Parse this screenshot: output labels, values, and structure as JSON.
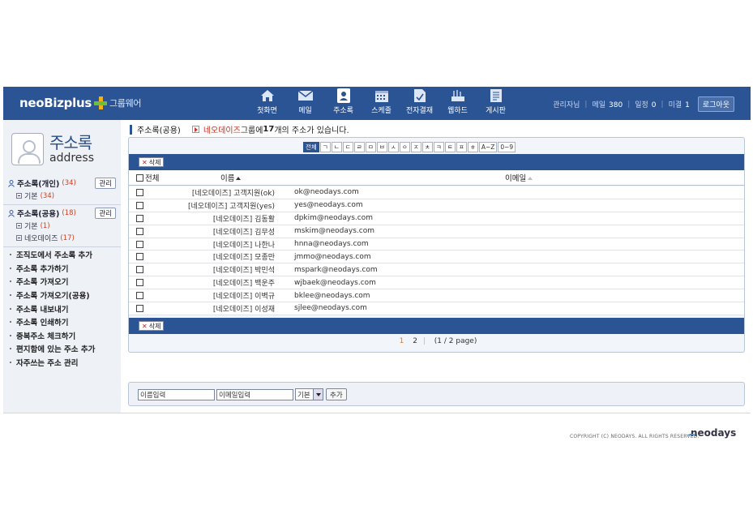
{
  "header": {
    "logo_main": "neoBizplus",
    "logo_sub": "그룹웨어",
    "nav": [
      {
        "label": "첫화면",
        "icon": "home-icon"
      },
      {
        "label": "메일",
        "icon": "mail-icon"
      },
      {
        "label": "주소록",
        "icon": "addressbook-icon",
        "active": true
      },
      {
        "label": "스케줄",
        "icon": "calendar-icon"
      },
      {
        "label": "전자결재",
        "icon": "approval-icon"
      },
      {
        "label": "웹하드",
        "icon": "webhard-icon"
      },
      {
        "label": "게시판",
        "icon": "board-icon"
      }
    ],
    "user_name": "관리자님",
    "mail_label": "메일",
    "mail_count": "380",
    "schedule_label": "일정",
    "schedule_count": "0",
    "pending_label": "미결",
    "pending_count": "1",
    "logout_label": "로그아웃"
  },
  "sidebar": {
    "title_ko": "주소록",
    "title_en": "address",
    "personal": {
      "label": "주소록(개인)",
      "count": "(34)",
      "manage": "관리",
      "subs": [
        {
          "label": "기본",
          "count": "(34)"
        }
      ]
    },
    "shared": {
      "label": "주소록(공용)",
      "count": "(18)",
      "manage": "관리",
      "subs": [
        {
          "label": "기본",
          "count": "(1)"
        },
        {
          "label": "네오데이즈",
          "count": "(17)"
        }
      ]
    },
    "menu": [
      "조직도에서 주소록 추가",
      "주소록 추가하기",
      "주소록 가져오기",
      "주소록 가져오기(공용)",
      "주소록 내보내기",
      "주소록 인쇄하기",
      "중복주소 체크하기",
      "편지함에 있는 주소 추가",
      "자주쓰는 주소 관리"
    ]
  },
  "main": {
    "page_title": "주소록(공용)",
    "company": "네오데이즈",
    "desc_pre": "그룹에 ",
    "desc_count": "17",
    "desc_post": "개의 주소가 있습니다.",
    "alpha_tabs": [
      "전체",
      "ㄱ",
      "ㄴ",
      "ㄷ",
      "ㄹ",
      "ㅁ",
      "ㅂ",
      "ㅅ",
      "ㅇ",
      "ㅈ",
      "ㅊ",
      "ㅋ",
      "ㅌ",
      "ㅍ",
      "ㅎ",
      "A~Z",
      "0~9"
    ],
    "delete_label": "삭제",
    "col_all": "전체",
    "col_name": "이름",
    "col_email": "이메일",
    "rows": [
      {
        "name": "[네오데이즈] 고객지원(ok)",
        "email": "ok@neodays.com"
      },
      {
        "name": "[네오데이즈] 고객지원(yes)",
        "email": "yes@neodays.com"
      },
      {
        "name": "[네오데이즈] 김동활",
        "email": "dpkim@neodays.com"
      },
      {
        "name": "[네오데이즈] 김무성",
        "email": "mskim@neodays.com"
      },
      {
        "name": "[네오데이즈] 나한나",
        "email": "hnna@neodays.com"
      },
      {
        "name": "[네오데이즈] 모종만",
        "email": "jmmo@neodays.com"
      },
      {
        "name": "[네오데이즈] 박민석",
        "email": "mspark@neodays.com"
      },
      {
        "name": "[네오데이즈] 백운주",
        "email": "wjbaek@neodays.com"
      },
      {
        "name": "[네오데이즈] 이벽규",
        "email": "bklee@neodays.com"
      },
      {
        "name": "[네오데이즈] 이성재",
        "email": "sjlee@neodays.com"
      }
    ],
    "pages": [
      "1",
      "2"
    ],
    "page_info": "(1 / 2 page)"
  },
  "add_form": {
    "name_value": "이름입력",
    "email_value": "이메일입력",
    "group_value": "기본",
    "add_label": "추가"
  },
  "footer": {
    "copyright": "COPYRIGHT (C) NEODAYS. ALL RIGHTS RESERVED.",
    "logo": "neodays"
  },
  "colors": {
    "header": "#2b5494",
    "sidebar": "#eef1f6",
    "accent_red": "#c03020",
    "page_orange": "#e07820"
  }
}
